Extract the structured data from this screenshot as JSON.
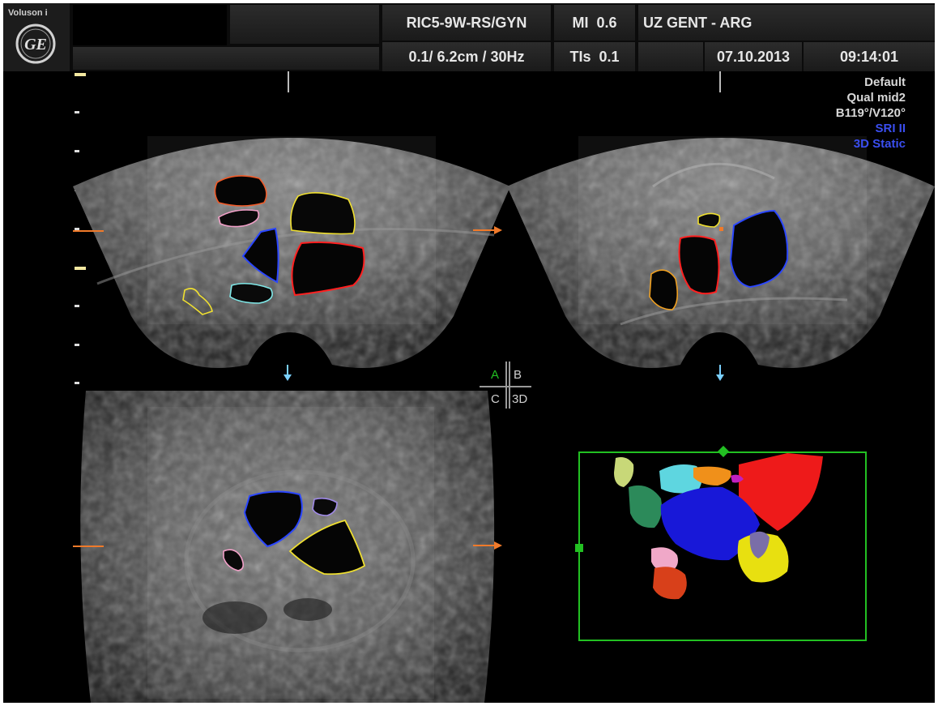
{
  "header": {
    "brand": "Voluson i",
    "logo": "GE",
    "probe": "RIC5-9W-RS/GYN",
    "mi": "MI  0.6",
    "institution": "UZ GENT - ARG",
    "depth_freq": "0.1/ 6.2cm / 30Hz",
    "tis": "TIs  0.1",
    "date": "07.10.2013",
    "time": "09:14:01"
  },
  "info_panel": {
    "lines": [
      "Default",
      "Qual mid2",
      "B119°/V120°"
    ],
    "mode_lines": [
      "SRI II",
      "3D Static"
    ]
  },
  "quad_selector": {
    "a": "A",
    "b": "B",
    "c": "C",
    "d": "3D"
  },
  "colors": {
    "background": "#000000",
    "header": "#1e1e1e",
    "info_text": "#d8d8d8",
    "mode_text": "#3a4ef0",
    "active_quad": "#22c022",
    "box": "#22c022"
  },
  "icons": {
    "logo": "ge-logo-icon",
    "orange_marker": "arrow-right-icon",
    "blue_marker": "arrow-down-icon"
  }
}
